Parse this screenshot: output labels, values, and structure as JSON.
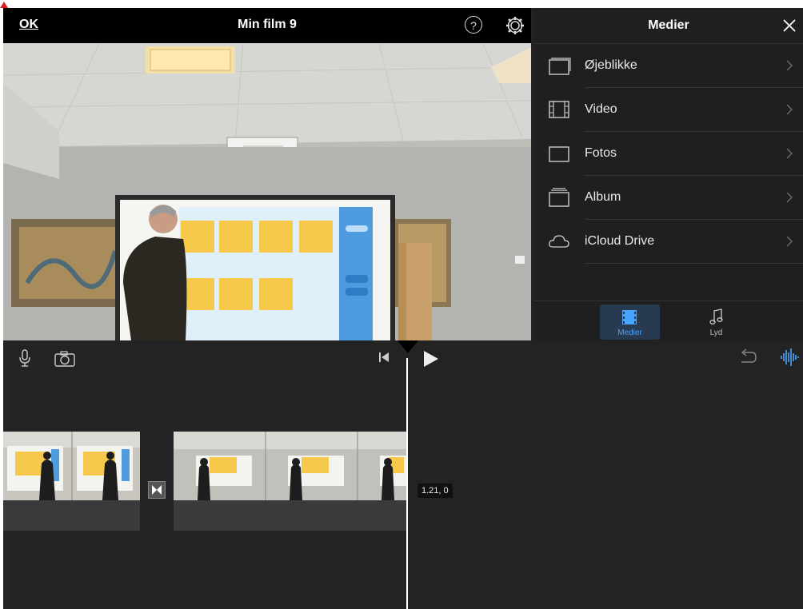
{
  "topbar": {
    "ok_label": "OK",
    "project_title": "Min film 9"
  },
  "media_panel": {
    "title": "Medier",
    "items": [
      {
        "label": "Øjeblikke",
        "icon": "moments-icon"
      },
      {
        "label": "Video",
        "icon": "film-strip-icon"
      },
      {
        "label": "Fotos",
        "icon": "photo-icon"
      },
      {
        "label": "Album",
        "icon": "album-icon"
      },
      {
        "label": "iCloud Drive",
        "icon": "cloud-icon"
      }
    ],
    "tabs": [
      {
        "label": "Medier",
        "icon": "media-tab-icon",
        "selected": true
      },
      {
        "label": "Lyd",
        "icon": "music-note-icon",
        "selected": false
      }
    ]
  },
  "timeline": {
    "time_label": "1.21, 0"
  },
  "colors": {
    "accent": "#4aa3ff",
    "panel_bg": "#1f1f1f",
    "timeline_bg": "#232323"
  }
}
